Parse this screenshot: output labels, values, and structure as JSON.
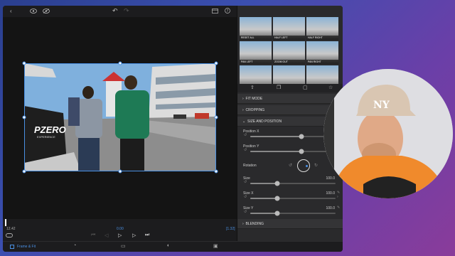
{
  "timeline": {
    "start_time": "12.42",
    "playhead_time": "0.00",
    "end_time": "[1.32]"
  },
  "bottom_bar": {
    "tab_label": "Frame & Fit"
  },
  "thumbnails": [
    {
      "label": "RESET ALL"
    },
    {
      "label": "HALF LEFT"
    },
    {
      "label": "HALF RIGHT"
    },
    {
      "label": "PAN LEFT"
    },
    {
      "label": "ZOOM OUT"
    },
    {
      "label": "PAN RIGHT"
    },
    {
      "label": ""
    },
    {
      "label": ""
    },
    {
      "label": ""
    }
  ],
  "sections": {
    "fit_mode": "FIT MODE",
    "cropping": "CROPPING",
    "size_position": "SIZE AND POSITION",
    "blending": "BLENDING"
  },
  "properties": {
    "position_x": {
      "label": "Position X",
      "level": 0.6
    },
    "position_y": {
      "label": "Position Y",
      "level": 0.6
    },
    "rotation": {
      "label": "Rotation"
    },
    "size": {
      "label": "Size",
      "value": "100.0",
      "level": 0.32
    },
    "size_x": {
      "label": "Size X",
      "value": "100.0",
      "level": 0.32
    },
    "size_y": {
      "label": "Size Y",
      "value": "100.0",
      "level": 0.32
    }
  },
  "photo": {
    "sign_text": "PZERO",
    "sign_subtext": "EXPERIENCE"
  },
  "colors": {
    "accent": "#4a90e2",
    "panel": "#2a2a2c",
    "background": "#1c1c1e"
  }
}
